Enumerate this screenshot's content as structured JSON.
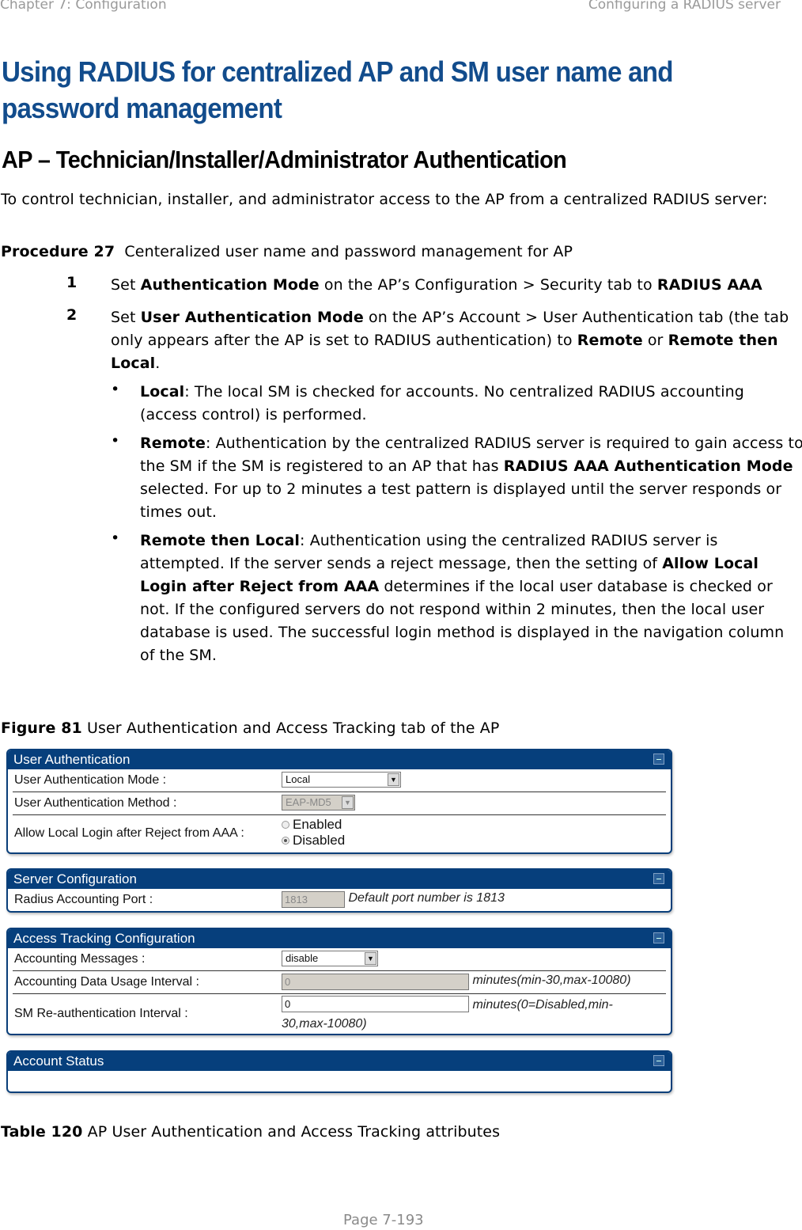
{
  "header": {
    "chapter": "Chapter 7:  Configuration",
    "section": "Configuring a RADIUS server"
  },
  "title_line1": "Using RADIUS for centralized AP and SM user name and",
  "title_line2": "password management",
  "subtitle": "AP – Technician/Installer/Administrator  Authentication",
  "intro": "To control technician, installer, and administrator access to the AP from a centralized RADIUS server:",
  "procedure": {
    "label": "Procedure 27",
    "text": "Centeralized user name and password management for AP"
  },
  "steps": [
    {
      "num": "1",
      "s": [
        "Set ",
        "Authentication Mode",
        " on the AP’s Configuration > Security tab to ",
        "RADIUS AAA"
      ]
    },
    {
      "num": "2",
      "s": [
        "Set ",
        "User Authentication Mode",
        " on the AP’s Account > User Authentication tab (the tab only appears after the AP is set to RADIUS authentication) to ",
        "Remote",
        " or ",
        "Remote then Local",
        "."
      ]
    }
  ],
  "bullets": [
    {
      "s": [
        "Local",
        ": The local SM is checked for accounts. No centralized RADIUS accounting (access control) is performed."
      ]
    },
    {
      "s": [
        "Remote",
        ": Authentication by the centralized RADIUS server is required to gain access to the SM if the SM is registered to an AP that has ",
        "RADIUS AAA Authentication Mode",
        " selected. For up to 2 minutes a test pattern is displayed until the server responds or times out."
      ]
    },
    {
      "s": [
        "Remote then Local",
        ": Authentication using the centralized RADIUS server is attempted. If the server sends a reject message, then the setting of ",
        "Allow Local Login after Reject from AAA",
        " determines if the local user database is checked or not. If the configured servers do not respond within 2 minutes, then the local user database is used. The successful login method is displayed in the navigation column of the SM."
      ]
    }
  ],
  "figure": {
    "label": "Figure 81",
    "text": "User Authentication and Access Tracking tab of the AP"
  },
  "ui": {
    "user_auth": {
      "title": "User Authentication",
      "mode_label": "User Authentication Mode :",
      "mode_value": "Local",
      "method_label": "User Authentication Method :",
      "method_value": "EAP-MD5",
      "allow_label": "Allow Local Login after Reject from AAA :",
      "enabled": "Enabled",
      "disabled": "Disabled",
      "selected": "Disabled"
    },
    "server": {
      "title": "Server Configuration",
      "port_label": "Radius Accounting Port :",
      "port_value": "1813",
      "port_hint": "Default port number is 1813"
    },
    "tracking": {
      "title": "Access Tracking Configuration",
      "msg_label": "Accounting Messages :",
      "msg_value": "disable",
      "usage_label": "Accounting Data Usage Interval :",
      "usage_value": "0",
      "usage_hint": "minutes(min-30,max-10080)",
      "reauth_label": "SM Re-authentication Interval :",
      "reauth_value": "0",
      "reauth_hint1": "minutes(0=Disabled,min-",
      "reauth_hint2": "30,max-10080)"
    },
    "status": {
      "title": "Account Status"
    }
  },
  "table": {
    "label": "Table 120",
    "text": "AP User Authentication and Access Tracking attributes"
  },
  "footer": "Page 7-193"
}
